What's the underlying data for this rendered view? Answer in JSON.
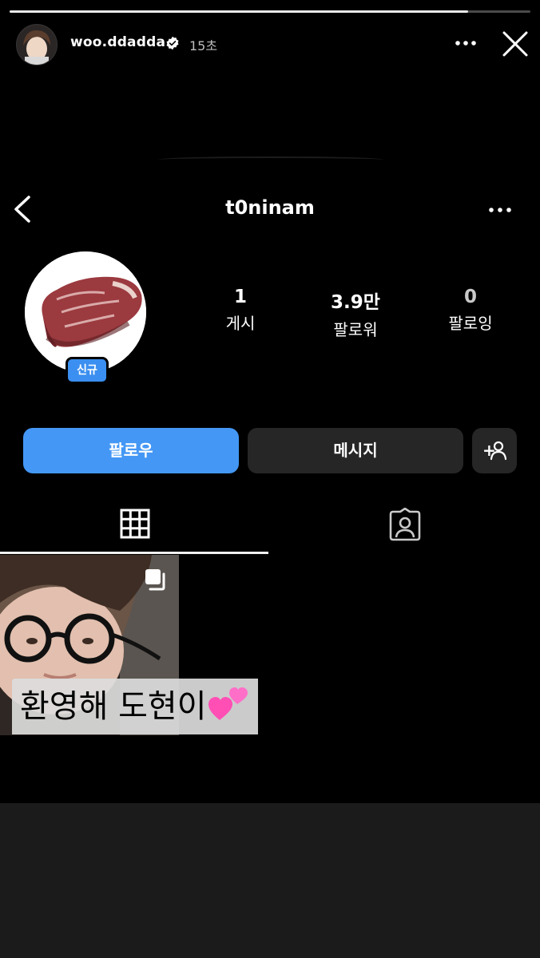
{
  "story": {
    "username": "woo.ddadda",
    "time": "15초",
    "progress": 0.88
  },
  "profile": {
    "username": "t0ninam",
    "badge": "신규",
    "stats": [
      {
        "value": "1",
        "label": "게시"
      },
      {
        "value": "3.9만",
        "label": "팔로워"
      },
      {
        "value": "0",
        "label": "팔로잉"
      }
    ]
  },
  "actions": {
    "follow": "팔로우",
    "message": "메시지",
    "add_user": "+"
  },
  "post": {
    "caption": "환영해 도현이"
  },
  "colors": {
    "follow_blue": "#4497f5",
    "badge_blue": "#3b8ff0",
    "button_dark": "#262626"
  }
}
